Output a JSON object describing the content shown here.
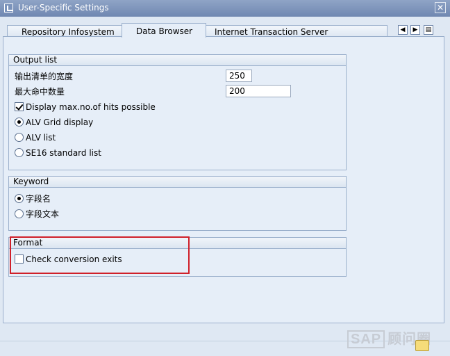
{
  "window": {
    "title": "User-Specific Settings",
    "close_glyph": "✕"
  },
  "tabs": [
    {
      "label": "Repository Infosystem",
      "active": false
    },
    {
      "label": "Data Browser",
      "active": true
    },
    {
      "label": "Internet Transaction Server",
      "active": false
    }
  ],
  "tab_nav": {
    "left_glyph": "◀",
    "right_glyph": "▶",
    "list_glyph": "▤"
  },
  "output_list": {
    "title": "Output list",
    "width_label": "输出清单的宽度",
    "width_value": "250",
    "max_hits_label": "最大命中数量",
    "max_hits_value": "200",
    "display_max_hits_label": "Display max.no.of hits possible",
    "display_max_hits_checked": true,
    "options": [
      {
        "label": "ALV Grid display",
        "selected": true
      },
      {
        "label": "ALV list",
        "selected": false
      },
      {
        "label": "SE16 standard list",
        "selected": false
      }
    ]
  },
  "keyword": {
    "title": "Keyword",
    "options": [
      {
        "label": "字段名",
        "selected": true
      },
      {
        "label": "字段文本",
        "selected": false
      }
    ]
  },
  "format": {
    "title": "Format",
    "check_conversion_label": "Check conversion exits",
    "check_conversion_checked": false
  },
  "watermark": {
    "sap": "SAP",
    "text": "顾问圈"
  },
  "colors": {
    "highlight": "#d0202a",
    "title_bar": "#7b93bb"
  }
}
